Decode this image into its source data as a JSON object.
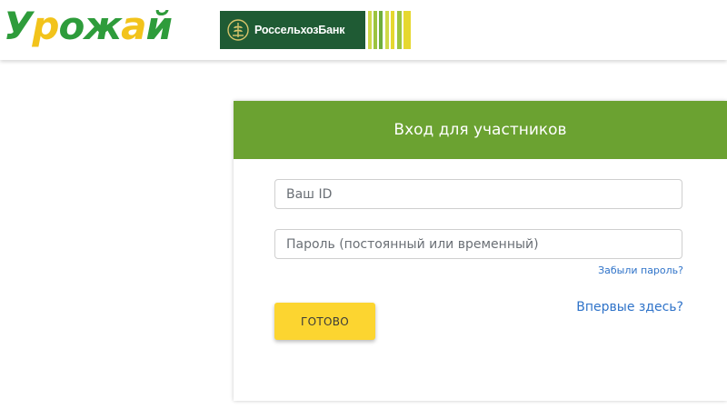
{
  "colors": {
    "logo_green": "#2e9c3b",
    "logo_yellow": "#f2c31b",
    "bank_dark": "#1f5b34",
    "bank_text": "#ffffff",
    "bank_stripes": [
      "#ffffff",
      "#cfd94a",
      "#ffffff",
      "#9cc43f",
      "#ffffff",
      "#6fae3c",
      "#ffffff",
      "#cfd94a",
      "#ffffff",
      "#e6d82f",
      "#ffffff",
      "#9cc43f",
      "#ffffff",
      "#e6d82f"
    ],
    "card_header_bg": "#6ba231",
    "card_header_text": "#ffffff",
    "link": "#2f73c9",
    "button_bg": "#fcd530",
    "button_text": "#3a3a3a"
  },
  "header": {
    "logo_text": "Урожай",
    "bank_name": "РоссельхозБанк",
    "bank_emblem_icon": "wheat-emblem-icon"
  },
  "login": {
    "title": "Вход для участников",
    "id_placeholder": "Ваш ID",
    "password_placeholder": "Пароль (постоянный или временный)",
    "forgot_label": "Забыли пароль?",
    "first_time_label": "Впервые здесь?",
    "submit_label": "ГОТОВО"
  }
}
